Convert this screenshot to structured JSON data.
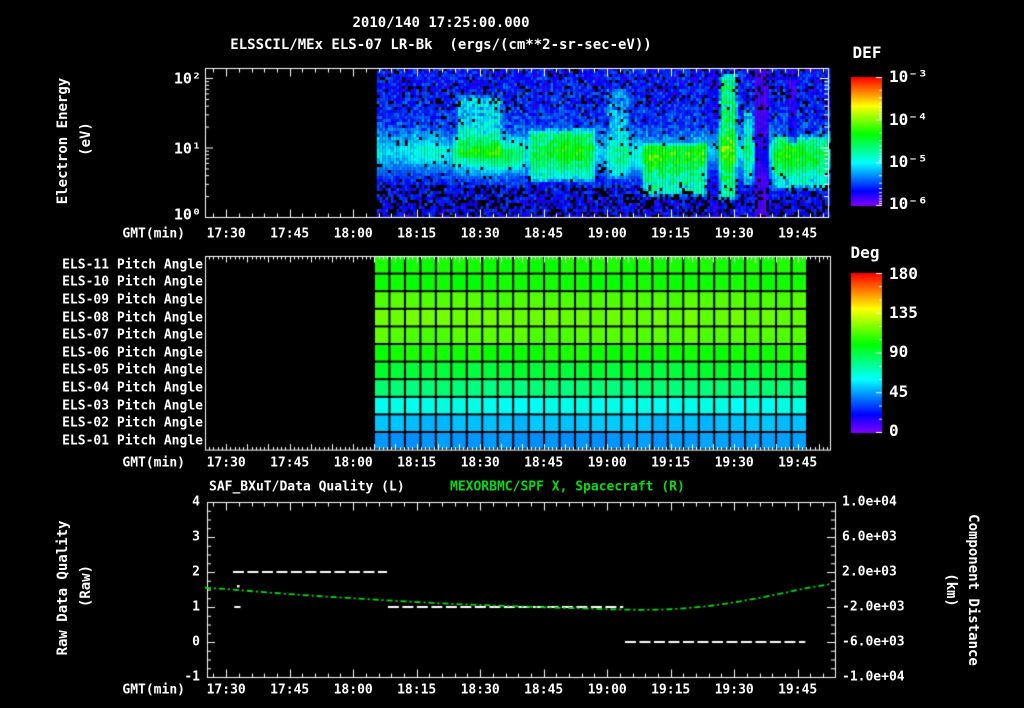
{
  "title": {
    "line1": "2010/140 17:25:00.000",
    "line2": "ELSSCIL/MEx ELS-07 LR-Bk  (ergs/(cm**2-sr-sec-eV))"
  },
  "colors": {
    "background": "#000000",
    "foreground": "#ffffff",
    "right_series_green": "#00dd11"
  },
  "time_axis": {
    "label": "GMT(min)",
    "start": "17:25:00",
    "tick_labels": [
      "17:30",
      "17:45",
      "18:00",
      "18:15",
      "18:30",
      "18:45",
      "19:00",
      "19:15",
      "19:30",
      "19:45"
    ]
  },
  "top_panel": {
    "ylabel_main": "Electron Energy",
    "ylabel_unit": "(eV)",
    "yticks": [
      "10²",
      "10¹",
      "10⁰"
    ],
    "gmt_label": "GMT(min)"
  },
  "def_colorbar": {
    "title": "DEF",
    "ticks": [
      "10⁻³",
      "10⁻⁴",
      "10⁻⁵",
      "10⁻⁶"
    ]
  },
  "deg_colorbar": {
    "title": "Deg",
    "ticks": [
      "180",
      "135",
      "90",
      "45",
      "0"
    ]
  },
  "pitch_panel": {
    "gmt_label": "GMT(min)"
  },
  "bottom_panel": {
    "title_left": "SAF_BXuT/Data Quality (L)",
    "title_right": "MEXORBMC/SPF X, Spacecraft (R)",
    "ylabel_left_main": "Raw Data Quality",
    "ylabel_left_unit": "(Raw)",
    "ylabel_right_main": "Component Distance",
    "ylabel_right_unit": "(km)",
    "left_ticks": [
      "4",
      "3",
      "2",
      "1",
      "0",
      "-1"
    ],
    "right_ticks": [
      "1.0e+04",
      "6.0e+03",
      "2.0e+03",
      "-2.0e+03",
      "-6.0e+03",
      "-1.0e+04"
    ],
    "gmt_label": "GMT(min)"
  },
  "chart_data": [
    {
      "type": "heatmap",
      "name": "electron-energy-spectrogram",
      "title": "ELSSCIL/MEx ELS-07 LR-Bk",
      "units": "ergs/(cm**2-sr-sec-eV)",
      "xlabel": "GMT(min)",
      "ylabel": "Electron Energy (eV)",
      "y_scale": "log",
      "y_range_ev": [
        1,
        140
      ],
      "color_scale": {
        "title": "DEF",
        "min": "10⁻⁶",
        "max": "10⁻³"
      },
      "x_range_gmt": [
        "17:25",
        "19:52"
      ],
      "data_start_gmt": "18:05",
      "data_end_gmt": "19:52",
      "t_data_start_min": 40.6,
      "t_end_min": 147.2,
      "main_band": {
        "center_ev": 8.5,
        "width_log": 0.17,
        "strength": 0.17,
        "boost": {
          "t0": 58,
          "t1": 75,
          "amp": 0.12
        }
      },
      "features": [
        {
          "t0": 59,
          "t1": 70,
          "e0": 0.85,
          "e1": 1.8,
          "amp": 0.16,
          "note": "green columns 18:24-18:35"
        },
        {
          "t0": 76,
          "t1": 92,
          "e0": 0.5,
          "e1": 1.3,
          "amp": 0.2,
          "note": "green patches 18:41-18:57"
        },
        {
          "t0": 94.5,
          "t1": 100,
          "e0": 0.55,
          "e1": 1.9,
          "amp": 0.12,
          "note": "tall cyan column ~19:00"
        },
        {
          "t0": 103,
          "t1": 118.5,
          "e0": 0.3,
          "e1": 1.1,
          "amp": 0.26,
          "note": "green blob 19:08-19:23"
        },
        {
          "t0": 121,
          "t1": 125.5,
          "e0": 0.25,
          "e1": 2.1,
          "amp": 0.3,
          "note": "bright full-height streak ~19:27"
        },
        {
          "t0": 126.5,
          "t1": 129.5,
          "e0": 0.45,
          "e1": 1.6,
          "amp": 0.16,
          "note": "green streaks ~19:32"
        },
        {
          "t0": 133.5,
          "t1": 147.2,
          "e0": 0.4,
          "e1": 1.2,
          "amp": 0.2,
          "note": "green band 19:38-end"
        }
      ],
      "gaps": [
        {
          "t0": 129.5,
          "t1": 133,
          "factor": 0.3,
          "note": "dark vertical gap 19:34-19:38"
        },
        {
          "t0": 118.6,
          "t1": 120.9,
          "factor": 0.75,
          "note": "dim lane 19:23-19:26"
        },
        {
          "t0": 137.5,
          "t1": 139.2,
          "factor": 0.55,
          "e_min": 1.1,
          "note": "dark upper notch ~19:43"
        }
      ]
    },
    {
      "type": "heatmap",
      "name": "pitch-angle-grid",
      "color_scale": {
        "title": "Deg",
        "min": 0,
        "max": 180
      },
      "data_start_gmt": "18:05",
      "data_end_gmt": "19:47",
      "t_start_min": 40,
      "t_end_min": 142.2,
      "columns": 28,
      "rows": [
        {
          "label": "ELS-11 Pitch Angle",
          "angle_deg": 103
        },
        {
          "label": "ELS-10 Pitch Angle",
          "angle_deg": 102
        },
        {
          "label": "ELS-09 Pitch Angle",
          "angle_deg": 112
        },
        {
          "label": "ELS-08 Pitch Angle",
          "angle_deg": 116
        },
        {
          "label": "ELS-07 Pitch Angle",
          "angle_deg": 113
        },
        {
          "label": "ELS-06 Pitch Angle",
          "angle_deg": 103
        },
        {
          "label": "ELS-05 Pitch Angle",
          "angle_deg": 92
        },
        {
          "label": "ELS-04 Pitch Angle",
          "angle_deg": 81
        },
        {
          "label": "ELS-03 Pitch Angle",
          "angle_deg": 63
        },
        {
          "label": "ELS-02 Pitch Angle",
          "angle_deg": 50
        },
        {
          "label": "ELS-01 Pitch Angle",
          "angle_deg": 44
        }
      ]
    },
    {
      "type": "line",
      "name": "quality-and-distance",
      "title_left": "SAF_BXuT/Data Quality (L)",
      "title_right": "MEXORBMC/SPF X, Spacecraft (R)",
      "left_axis": {
        "label": "Raw Data Quality (Raw)",
        "range": [
          -1,
          4
        ],
        "ticks": [
          4,
          3,
          2,
          1,
          0,
          -1
        ]
      },
      "right_axis": {
        "label": "Component Distance (km)",
        "range": [
          -10000,
          10000
        ],
        "ticks": [
          "1.0e+04",
          "6.0e+03",
          "2.0e+03",
          "-2.0e+03",
          "-6.0e+03",
          "-1.0e+04"
        ]
      },
      "t_unit": "minutes after 17:25",
      "series": [
        {
          "name": "Raw Data Quality",
          "axis": "left",
          "color": "#ffffff",
          "style": "dashed",
          "segments": [
            {
              "t0": 6.6,
              "t1": 43.0,
              "value": 2
            },
            {
              "t0": 43.2,
              "t1": 98.8,
              "value": 1
            },
            {
              "t0": 99.2,
              "t1": 141.8,
              "value": 0
            },
            {
              "t0": 6.9,
              "t1": 8.4,
              "value": 1
            }
          ],
          "points": [
            {
              "t": 7.8,
              "value": 1.6
            }
          ]
        },
        {
          "name": "Spacecraft X",
          "axis": "right",
          "color": "#00dd11",
          "style": "dash-dot-dot",
          "points_t_km": [
            [
              0,
              200
            ],
            [
              5,
              60
            ],
            [
              15,
              -350
            ],
            [
              25,
              -700
            ],
            [
              35,
              -1000
            ],
            [
              45,
              -1300
            ],
            [
              55,
              -1570
            ],
            [
              65,
              -1780
            ],
            [
              75,
              -1950
            ],
            [
              85,
              -2100
            ],
            [
              95,
              -2250
            ],
            [
              102,
              -2320
            ],
            [
              108,
              -2300
            ],
            [
              112,
              -2200
            ],
            [
              118,
              -1950
            ],
            [
              124,
              -1550
            ],
            [
              130,
              -1050
            ],
            [
              136,
              -480
            ],
            [
              142,
              150
            ],
            [
              147.5,
              600
            ]
          ]
        }
      ]
    }
  ]
}
